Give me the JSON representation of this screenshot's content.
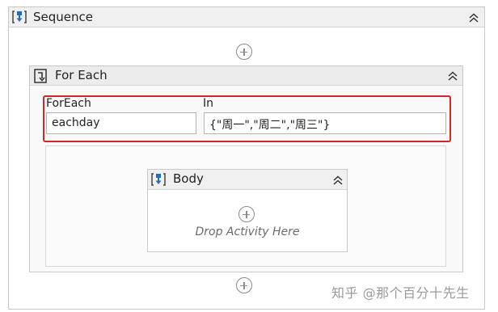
{
  "sequence": {
    "title": "Sequence",
    "icon": "sequence-icon",
    "collapse_icon": "collapse-chevrons-icon"
  },
  "foreach": {
    "title": "For Each",
    "icon": "foreach-icon",
    "item_label": "ForEach",
    "item_value": "eachday",
    "in_label": "In",
    "in_value": "{\"周一\",\"周二\",\"周三\"}"
  },
  "body": {
    "title": "Body",
    "icon": "sequence-icon",
    "drop_text": "Drop Activity Here"
  },
  "watermark": "知乎 @那个百分十先生",
  "colors": {
    "highlight_border": "#d0272b",
    "icon_blue": "#1f6fc5"
  }
}
